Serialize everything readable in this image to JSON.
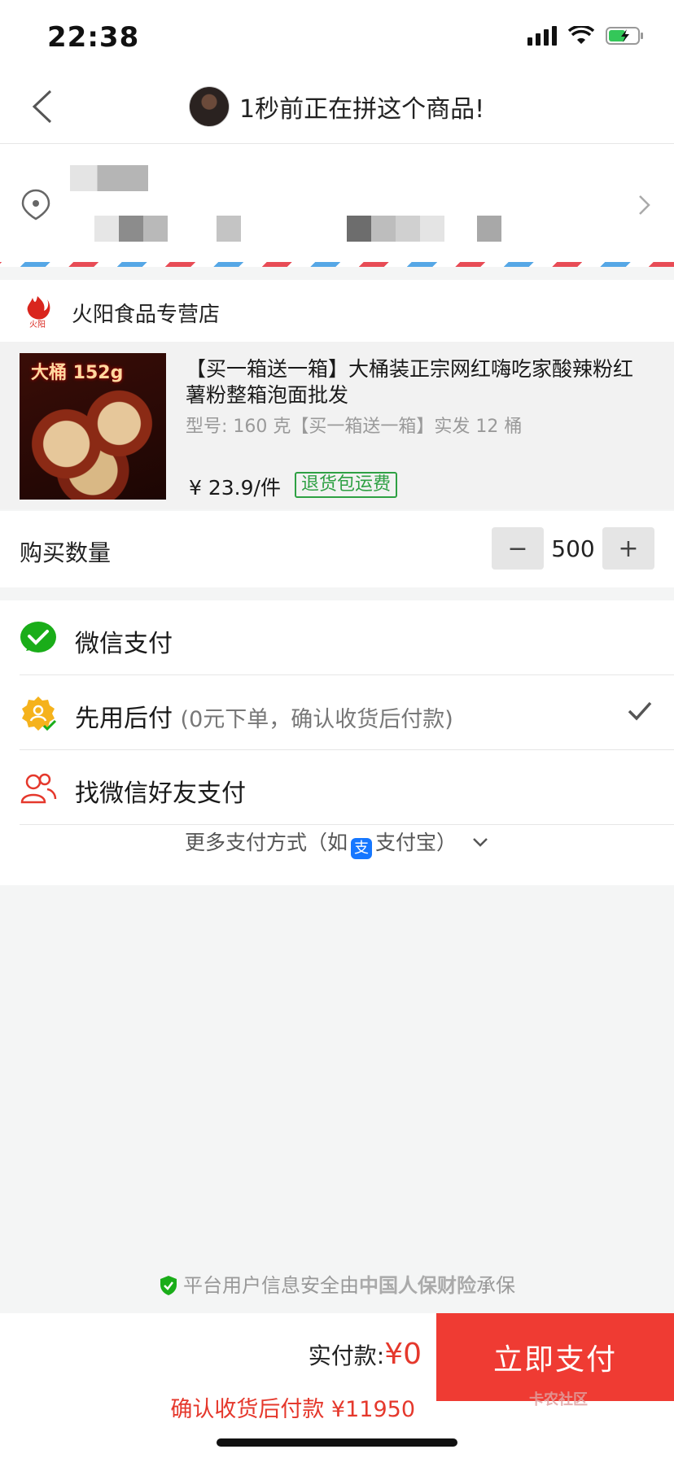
{
  "status_bar": {
    "time": "22:38"
  },
  "nav": {
    "title": "1秒前正在拼这个商品!"
  },
  "shop": {
    "name": "火阳食品专营店",
    "logo_text": "火阳"
  },
  "product": {
    "image_label": "大桶 152g",
    "title": "【买一箱送一箱】大桶装正宗网红嗨吃家酸辣粉红薯粉整箱泡面批发",
    "spec": "型号: 160 克【买一箱送一箱】实发 12 桶",
    "price": "¥ 23.9/件",
    "badge": "退货包运费"
  },
  "quantity": {
    "label": "购买数量",
    "value": "500",
    "minus": "−",
    "plus": "+"
  },
  "payment": {
    "options": [
      {
        "label": "微信支付",
        "note": ""
      },
      {
        "label": "先用后付",
        "note": "(0元下单，确认收货后付款)",
        "selected": true
      },
      {
        "label": "找微信好友支付",
        "note": ""
      }
    ],
    "more_prefix": "更多支付方式（如",
    "alipay_icon_text": "支",
    "more_suffix": "支付宝）"
  },
  "security": {
    "prefix": "平台用户信息安全由",
    "insurer": "中国人保财险",
    "suffix": "承保"
  },
  "bottom": {
    "paid_label": "实付款:",
    "paid_amount": "¥0",
    "after_pay": "确认收货后付款 ¥11950",
    "pay_button": "立即支付",
    "watermark": "卡农社区"
  },
  "colors": {
    "accent_red": "#ef3b33",
    "wechat_green": "#1aad19",
    "badge_green": "#2ea043"
  }
}
